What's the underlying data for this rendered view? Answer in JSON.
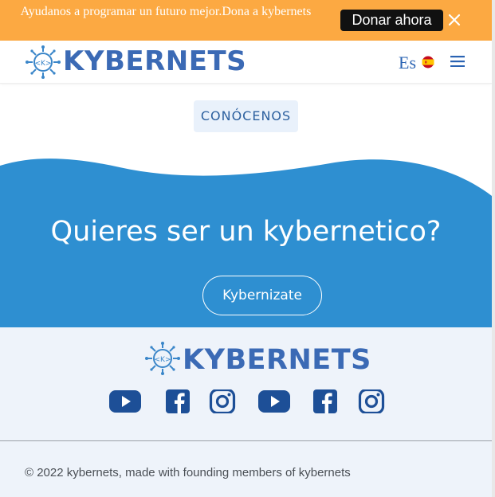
{
  "banner": {
    "text": "Ayudanos a programar un futuro mejor.Dona a kybernets",
    "donate_label": "Donar ahora",
    "close_icon": "close-icon"
  },
  "navbar": {
    "brand": "KYBERNETS",
    "logo_inner": "<K>",
    "language": "Es",
    "flag_icon": "spain-flag-icon",
    "menu_icon": "hamburger-menu-icon"
  },
  "about": {
    "label": "CONÓCENOS"
  },
  "cta": {
    "title": "Quieres ser un kybernetico?",
    "button_label": "Kybernizate"
  },
  "footer": {
    "brand": "KYBERNETS",
    "logo_inner": "<K>",
    "social": [
      "youtube-icon",
      "facebook-icon",
      "instagram-icon",
      "youtube-icon",
      "facebook-icon",
      "instagram-icon"
    ],
    "copyright": "© 2022 kybernets, made with founding members of kybernets"
  },
  "colors": {
    "banner": "#fca942",
    "brand_blue": "#3b6ab5",
    "cta_blue": "#2e8fd1",
    "footer_bg": "#eef3fa",
    "social_blue": "#1d4f97"
  }
}
